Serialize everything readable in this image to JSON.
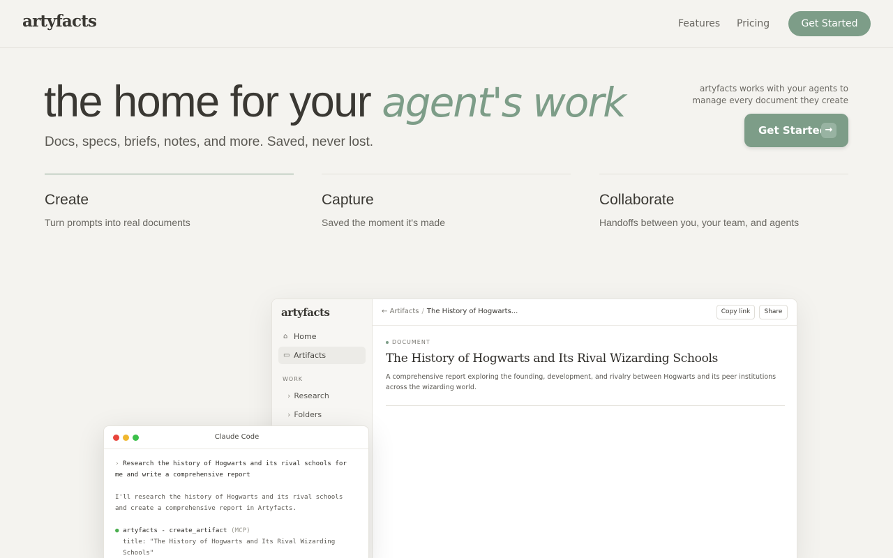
{
  "nav": {
    "logo": "artyfacts",
    "links": [
      "Features",
      "Pricing"
    ],
    "cta": "Get Started"
  },
  "hero": {
    "title_plain": "the home for your ",
    "title_accent": "agent's work",
    "subtitle": "Docs, specs, briefs, notes, and more. Saved, never lost.",
    "side_note": "artyfacts works with your agents to manage every document they create",
    "cta": "Get Started",
    "cta_arrow": "→"
  },
  "features": [
    {
      "title": "Create",
      "desc": "Turn prompts into real documents",
      "active": true
    },
    {
      "title": "Capture",
      "desc": "Saved the moment it's made",
      "active": false
    },
    {
      "title": "Collaborate",
      "desc": "Handoffs between you, your team, and agents",
      "active": false
    }
  ],
  "app": {
    "logo": "artyfacts",
    "nav": [
      {
        "label": "Home",
        "icon": "home-icon"
      },
      {
        "label": "Artifacts",
        "icon": "box-icon"
      }
    ],
    "section": "WORK",
    "subnav": [
      "Research",
      "Folders"
    ],
    "breadcrumb": {
      "back": "←",
      "parent": "Artifacts",
      "separator": "/",
      "current": "The History of Hogwarts..."
    },
    "actions": [
      "Copy link",
      "Share"
    ],
    "doc": {
      "tag": "DOCUMENT",
      "title": "The History of Hogwarts and Its Rival Wizarding Schools",
      "description": "A comprehensive report exploring the founding, development, and rivalry between Hogwarts and its peer institutions across the wizarding world."
    }
  },
  "terminal": {
    "title": "Claude Code",
    "prompt_marker": "›",
    "prompt": "Research the history of Hogwarts and its rival schools for\nme and write a comprehensive report",
    "response": "I'll research the history of Hogwarts and its rival schools\nand create a comprehensive report in Artyfacts.",
    "tool_bullet": "●",
    "tool_name": "artyfacts - create_artifact",
    "tool_tag": "(MCP)",
    "tool_args": "  title: \"The History of Hogwarts and Its Rival Wizarding\n  Schools\"\n  type: \"doc\"",
    "light_colors": [
      "#e8453c",
      "#f0b72f",
      "#3cc04a"
    ]
  },
  "colors": {
    "accent": "#7d9d88",
    "background": "#f4f3ef"
  }
}
